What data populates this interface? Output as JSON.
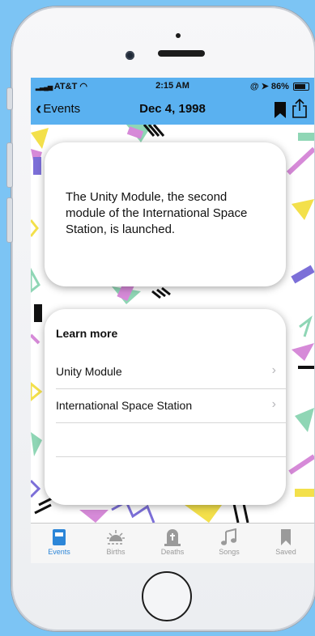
{
  "status_bar": {
    "carrier": "AT&T",
    "time": "2:15 AM",
    "battery": "86%"
  },
  "nav": {
    "back_label": "Events",
    "title": "Dec 4, 1998"
  },
  "event": {
    "text": "The Unity Module, the second module of the International Space Station, is launched."
  },
  "learn_more": {
    "title": "Learn more",
    "items": [
      {
        "label": "Unity Module"
      },
      {
        "label": "International Space Station"
      }
    ]
  },
  "tabs": [
    {
      "label": "Events",
      "icon": "events-icon",
      "active": true
    },
    {
      "label": "Births",
      "icon": "births-icon",
      "active": false
    },
    {
      "label": "Deaths",
      "icon": "deaths-icon",
      "active": false
    },
    {
      "label": "Songs",
      "icon": "songs-icon",
      "active": false
    },
    {
      "label": "Saved",
      "icon": "saved-icon",
      "active": false
    }
  ],
  "colors": {
    "background": "#7cc4f4",
    "nav_bar": "#5ab1f0",
    "tab_active": "#2c86d8",
    "tab_inactive": "#9a9a9a"
  }
}
